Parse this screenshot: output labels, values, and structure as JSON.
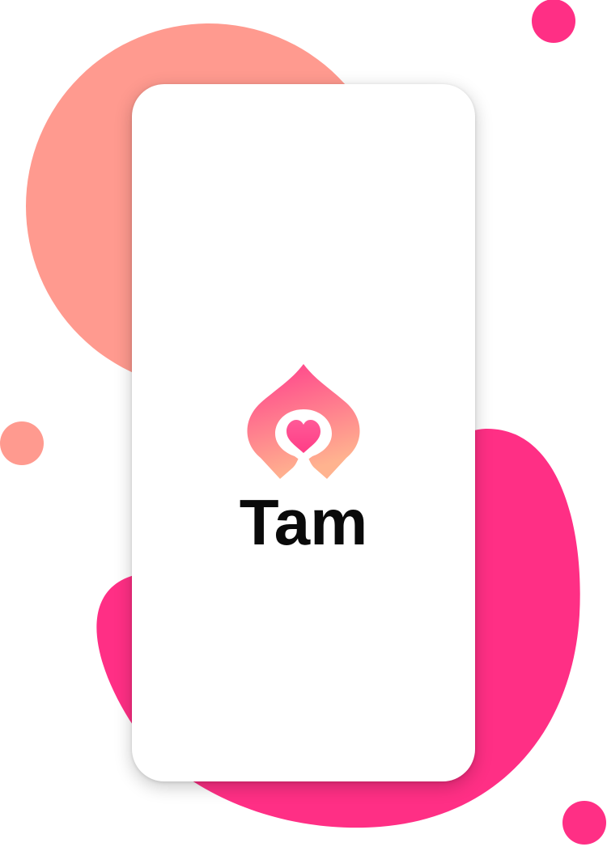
{
  "app": {
    "name": "Tam",
    "logo_icon": "heart-teardrop-logo-icon"
  },
  "colors": {
    "accent_pink": "#ff2f85",
    "accent_salmon": "#ff9a8f",
    "logo_gradient_top": "#ff4f93",
    "logo_gradient_bottom": "#ffb38f",
    "text": "#0a0a0a",
    "background": "#ffffff"
  },
  "decorations": [
    "salmon-blob",
    "pink-blob",
    "pink-dot-top-right",
    "salmon-dot-left",
    "pink-dot-bottom-right"
  ]
}
